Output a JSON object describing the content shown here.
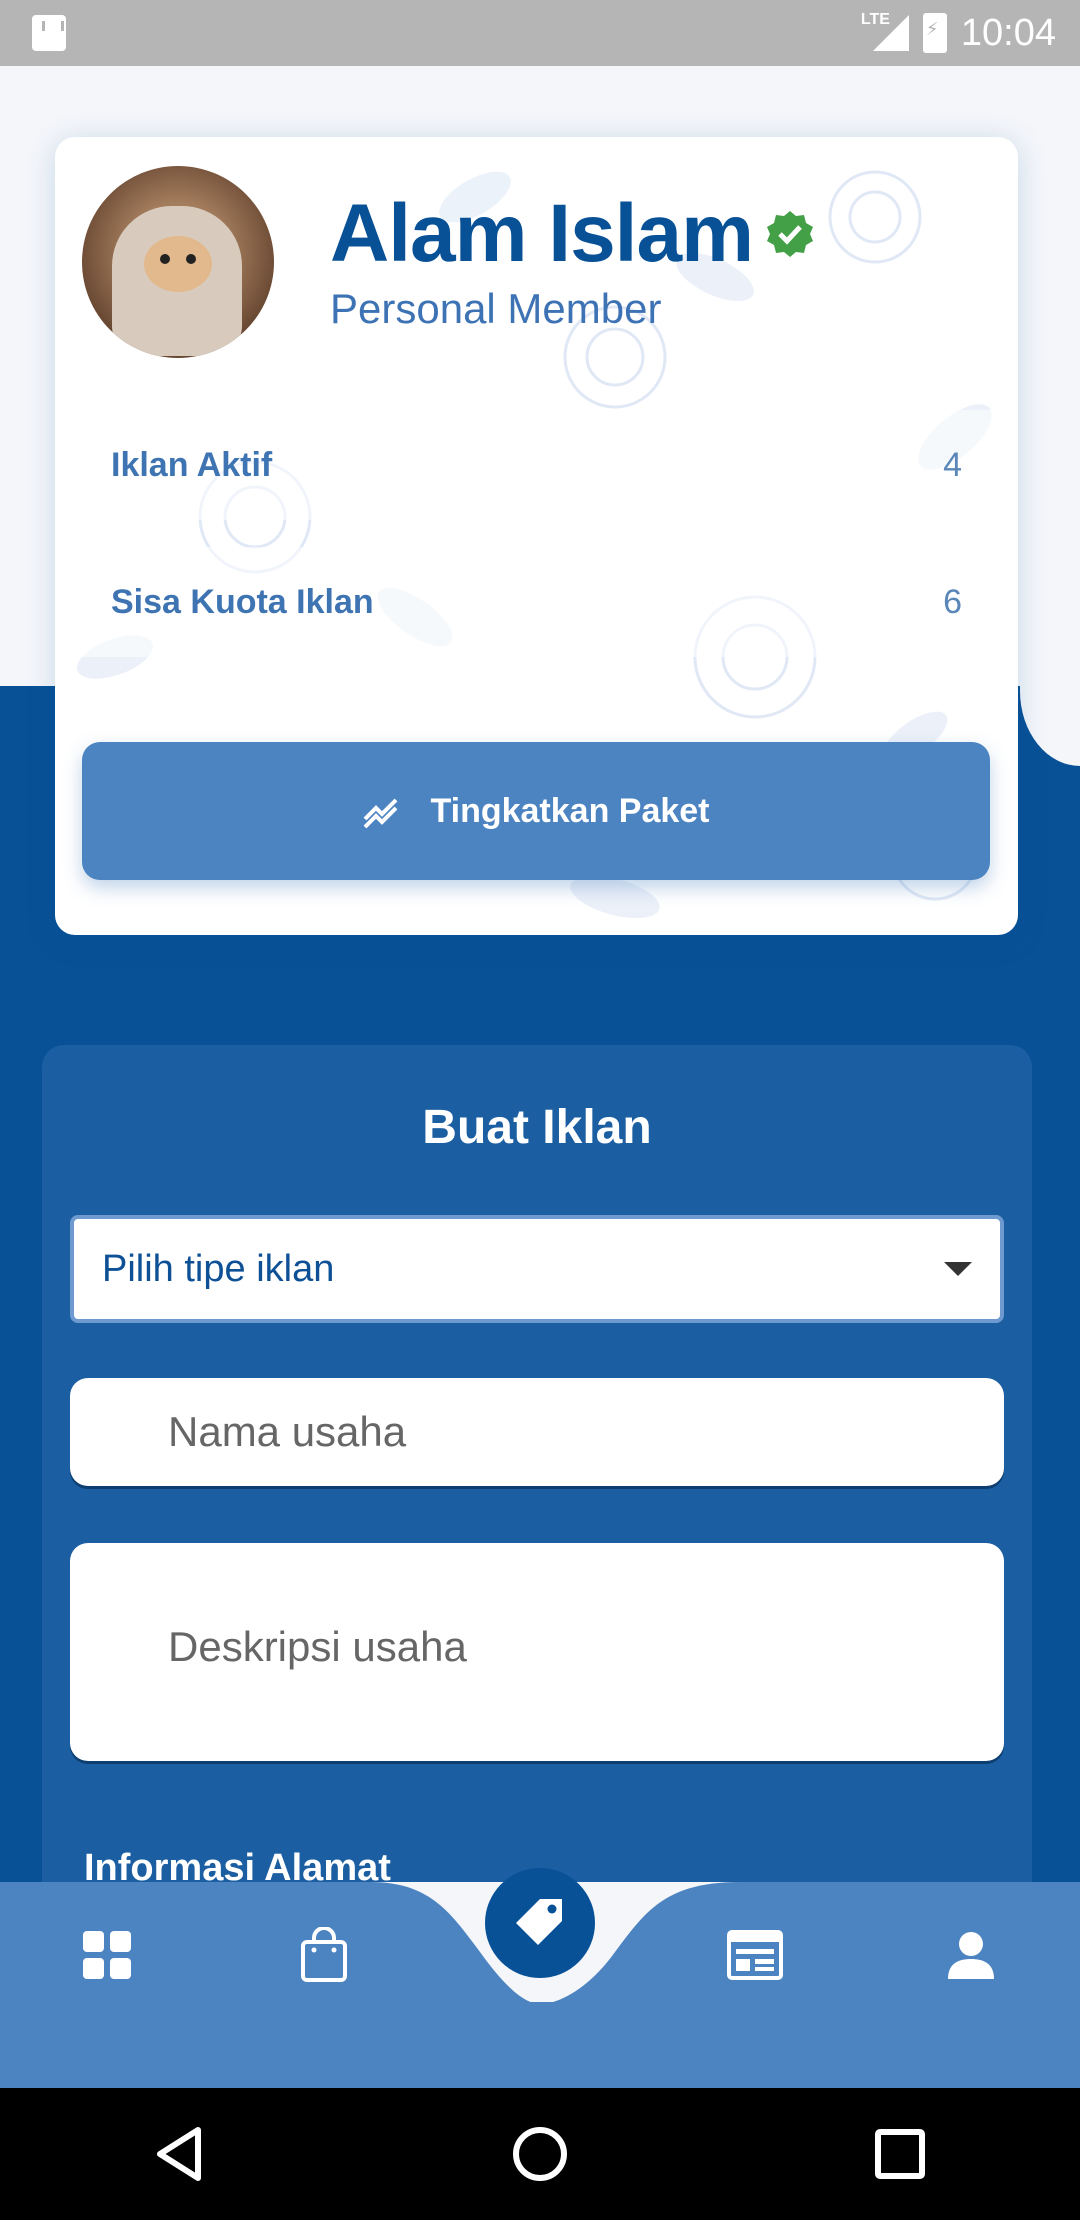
{
  "status_bar": {
    "network": "LTE",
    "time": "10:04"
  },
  "profile": {
    "name": "Alam Islam",
    "member_type": "Personal Member",
    "stats": [
      {
        "label": "Iklan Aktif",
        "value": "4"
      },
      {
        "label": "Sisa Kuota Iklan",
        "value": "6"
      }
    ],
    "upgrade_label": "Tingkatkan Paket"
  },
  "create_ad": {
    "title": "Buat Iklan",
    "type_select": {
      "value": "Pilih tipe iklan"
    },
    "business_name": {
      "placeholder": "Nama usaha"
    },
    "business_desc": {
      "placeholder": "Deskripsi usaha"
    },
    "address_section": "Informasi Alamat"
  },
  "bottom_nav": {
    "items": [
      "dashboard-icon",
      "shopping-bag-icon",
      "tag-icon",
      "news-icon",
      "person-icon"
    ],
    "active": "tag-icon"
  },
  "colors": {
    "primary": "#085197",
    "accent": "#4c83c1",
    "panel": "#1b5ea1",
    "verified": "#43a047"
  }
}
